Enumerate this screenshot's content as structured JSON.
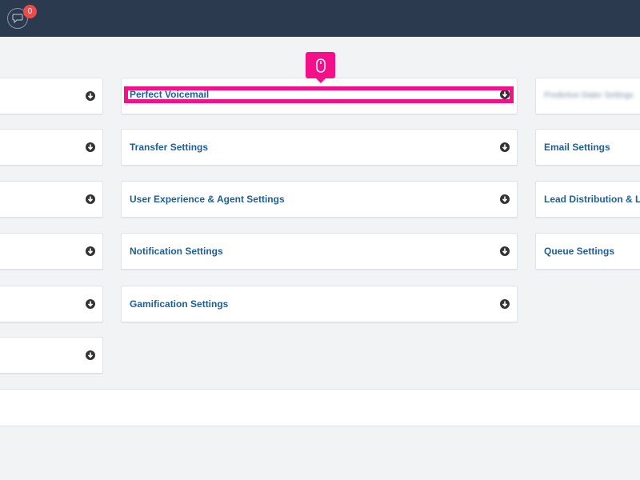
{
  "topbar": {
    "notification_count": "0",
    "chat_icon": "chat-bubble-icon",
    "background": "#2b3a4e",
    "badge_color": "#e84c4c"
  },
  "left_column": {
    "items": [
      {
        "label": ""
      },
      {
        "label": ""
      },
      {
        "label": ""
      },
      {
        "label": ""
      },
      {
        "label": ""
      },
      {
        "label": ""
      }
    ]
  },
  "middle_column": {
    "items": [
      {
        "label": "Perfect Voicemail"
      },
      {
        "label": "Transfer Settings"
      },
      {
        "label": "User Experience & Agent Settings"
      },
      {
        "label": "Notification Settings"
      },
      {
        "label": "Gamification Settings"
      }
    ]
  },
  "right_column": {
    "items": [
      {
        "label": "Predictive Dialer Settings"
      },
      {
        "label": "Email Settings"
      },
      {
        "label": "Lead Distribution & Lead"
      },
      {
        "label": "Queue Settings"
      }
    ]
  },
  "annotation": {
    "highlight_color": "#f5108a",
    "marker_icon": "mouse-click-icon"
  },
  "colors": {
    "link_text": "#1e5f99",
    "page_background": "#f2f3f5"
  }
}
